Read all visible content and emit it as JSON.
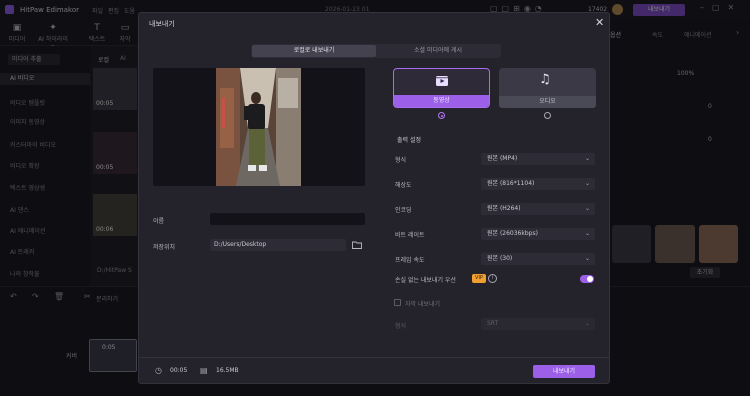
{
  "app": {
    "title": "HitPaw Edimakor",
    "menu": [
      "파일",
      "편집",
      "도움"
    ],
    "project_name": "2026-01-23 01",
    "credits": "17402",
    "export_label": "내보내기"
  },
  "toolbar": {
    "items": [
      {
        "label": "미디어",
        "icon": "media-icon"
      },
      {
        "label": "AI 하이라이트",
        "icon": "ai-icon"
      },
      {
        "label": "텍스트",
        "icon": "text-icon"
      },
      {
        "label": "자막",
        "icon": "subtitle-icon"
      }
    ]
  },
  "left_panel": {
    "dropdown": "미디어 추출",
    "items": [
      "AI 비디오",
      "비디오 템플릿",
      "이미지 동영상",
      "커스터마이 비디오",
      "비디오 확장",
      "텍스트 영상생",
      "AI 댄스",
      "AI 애니메이션",
      "AI 트래커",
      "나의 창작물"
    ]
  },
  "mid_panel": {
    "tabs": [
      "로컬",
      "AI"
    ],
    "thumb_durations": [
      "00:05",
      "00:05",
      "00:06"
    ],
    "path": "D:/HitPaw S"
  },
  "right_panel": {
    "tabs": [
      "옵션",
      "속도",
      "애니메이션"
    ],
    "zoom": "100%",
    "values": [
      "0",
      "0"
    ],
    "reset_label": "초기화"
  },
  "timeline": {
    "split_label": "분리하기",
    "track_label": "커버",
    "clip_duration": "0:05"
  },
  "modal": {
    "title": "내보내기",
    "tabs": [
      "로컬로 내보내기",
      "소셜 미디어에 게시"
    ],
    "name_label": "이름",
    "name_value": "",
    "path_label": "저장위치",
    "path_value": "D:/Users/Desktop",
    "type_cards": [
      {
        "label": "동영상",
        "icon": "film-icon",
        "selected": true
      },
      {
        "label": "오디오",
        "icon": "music-note-icon",
        "selected": false
      }
    ],
    "settings_heading": "출력 설정",
    "rows": [
      {
        "label": "형식",
        "value": "원본 (MP4)"
      },
      {
        "label": "해상도",
        "value": "원본 (816*1104)"
      },
      {
        "label": "인코딩",
        "value": "원본 (H264)"
      },
      {
        "label": "비트 레이트",
        "value": "원본 (26036kbps)"
      },
      {
        "label": "프레임 속도",
        "value": "원본 (30)"
      }
    ],
    "lossless": {
      "label": "손실 없는 내보내기 우선",
      "badge": "VIP",
      "enabled": true
    },
    "subtitle": {
      "label": "자막 내보내기",
      "format_label": "형식",
      "format_value": "SRT",
      "checked": false
    },
    "duration": "00:05",
    "size": "16.5MB",
    "export_button": "내보내기"
  },
  "colors": {
    "accent": "#9b5fe8",
    "modal_bg": "#24232c",
    "app_bg": "#16161d"
  }
}
